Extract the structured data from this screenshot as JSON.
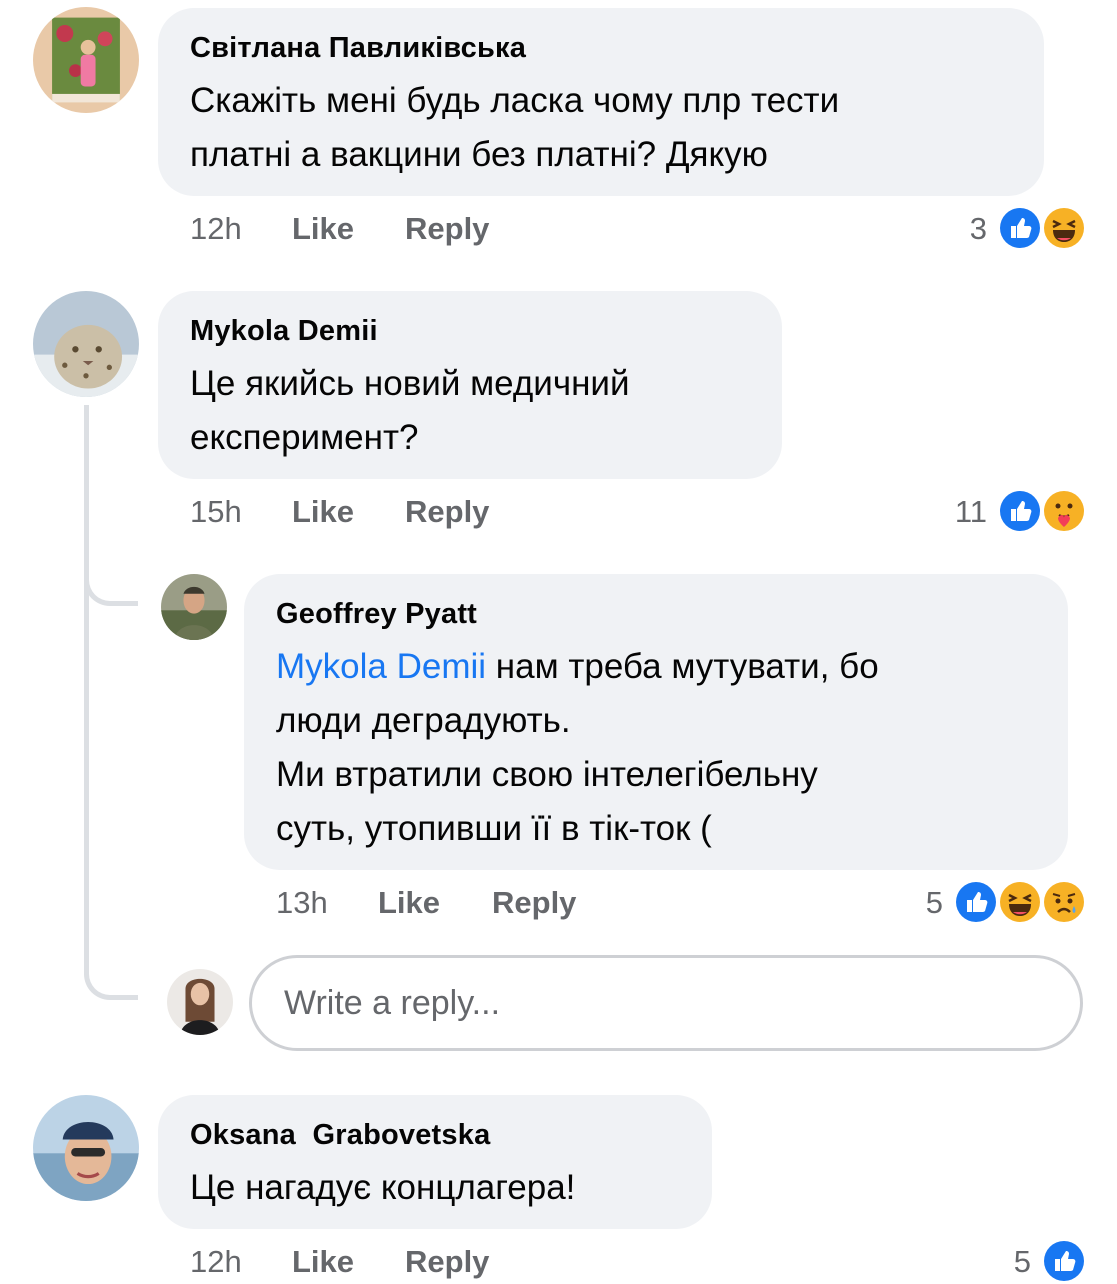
{
  "comments": [
    {
      "author": "Світлана Павликівська",
      "lines": [
        "Скажіть мені будь ласка чому плр тести",
        "платні а вакцини без платні? Дякую"
      ],
      "time": "12h",
      "like": "Like",
      "reply": "Reply",
      "reaction_count": "3",
      "reactions": [
        "like-icon",
        "laughing-icon"
      ]
    },
    {
      "author": "Mykola Demii",
      "lines": [
        "Це якийсь новий медичний",
        "експеримент?"
      ],
      "time": "15h",
      "like": "Like",
      "reply": "Reply",
      "reaction_count": "11",
      "reactions": [
        "like-icon",
        "care-icon"
      ],
      "replies": [
        {
          "author": "Geoffrey Pyatt",
          "mention": "Mykola Demii",
          "first_line_rest": " нам треба мутувати, бо",
          "lines": [
            "люди деградують.",
            "Ми втратили свою інтелегібельну",
            "суть, утопивши її в тік-ток ("
          ],
          "time": "13h",
          "like": "Like",
          "reply": "Reply",
          "reaction_count": "5",
          "reactions": [
            "like-icon",
            "laughing-icon",
            "sad-icon"
          ]
        }
      ],
      "reply_box": {
        "placeholder": "Write a reply..."
      }
    },
    {
      "author": "Oksana  Grabovetska",
      "lines": [
        "Це нагадує концлагера!"
      ],
      "time": "12h",
      "like": "Like",
      "reply": "Reply",
      "reaction_count": "5",
      "reactions": [
        "like-icon"
      ]
    }
  ],
  "colors": {
    "like_blue": "#1877f2",
    "bubble": "#f0f2f5",
    "meta_gray": "#65676b",
    "haha_yellow": "#f7b125"
  }
}
